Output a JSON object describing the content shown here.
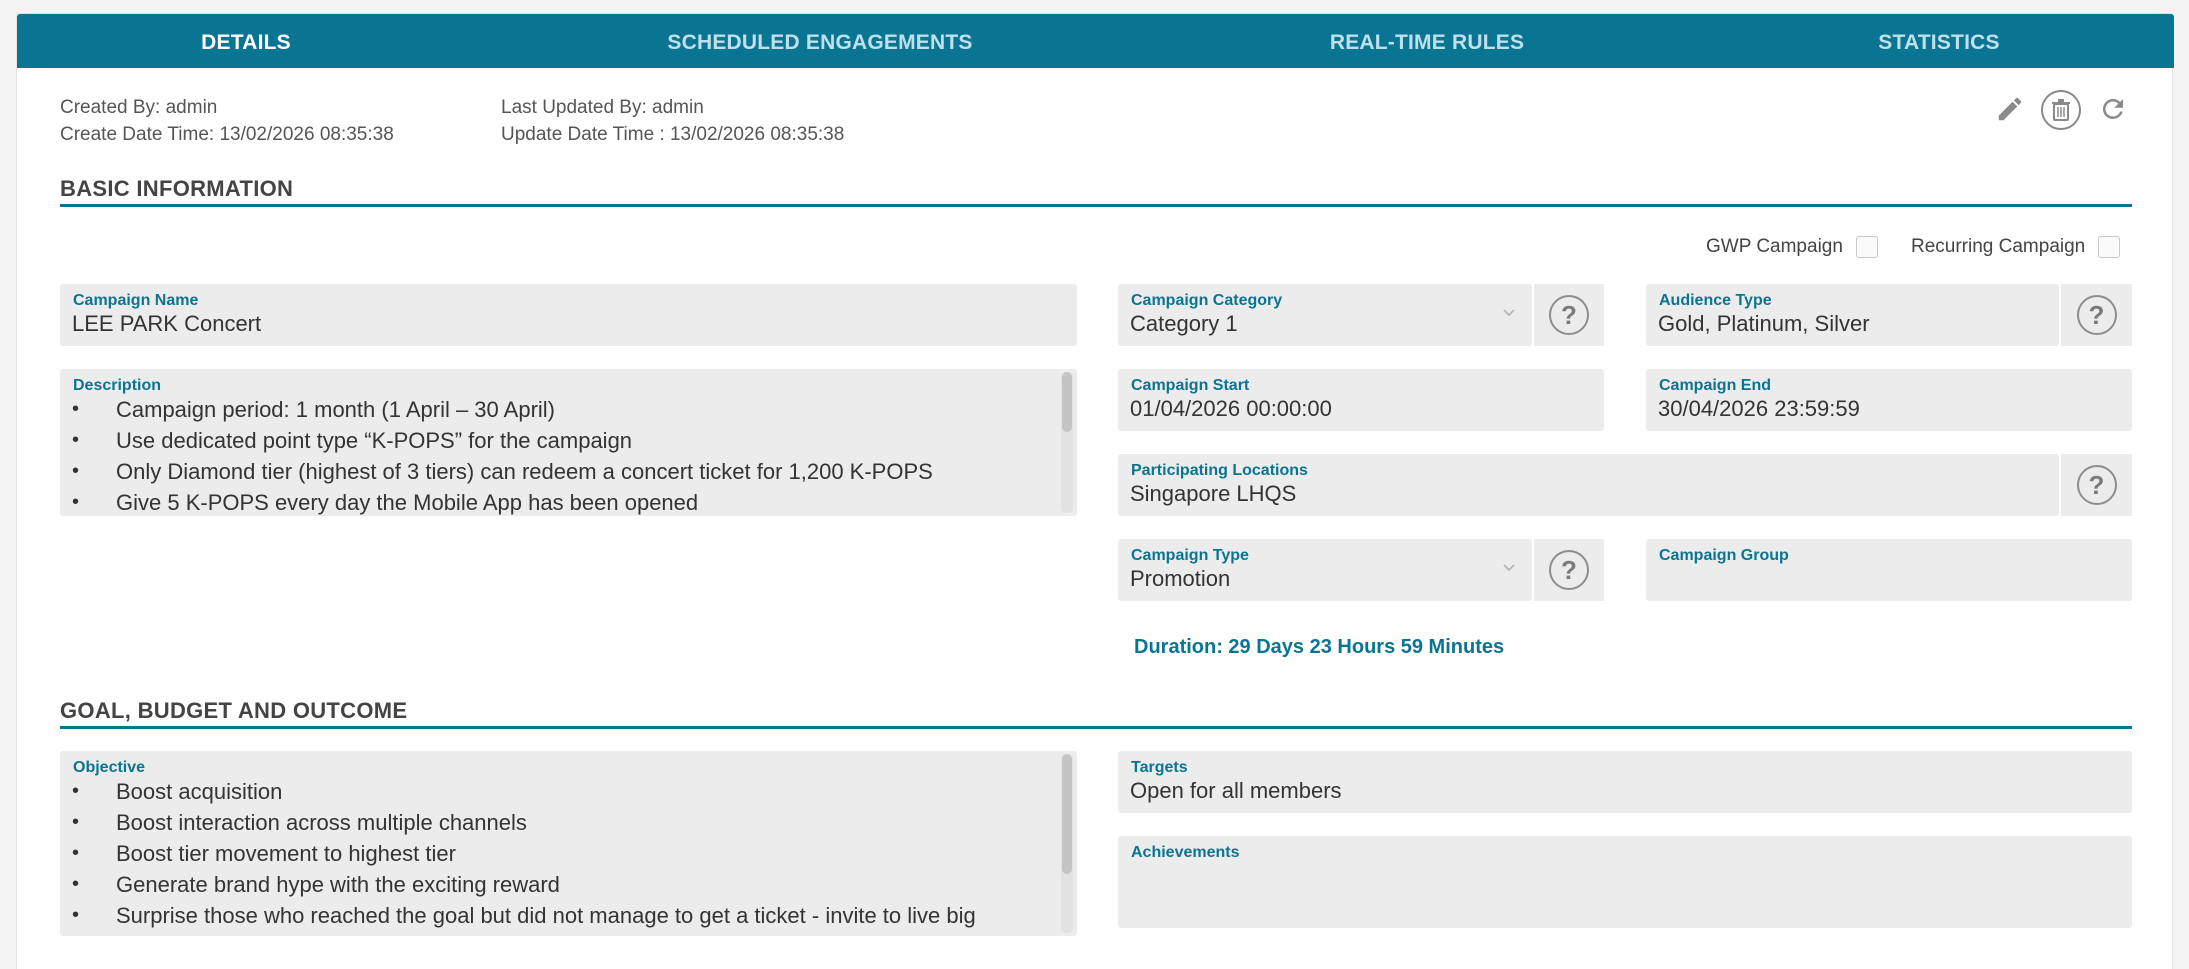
{
  "tabs": [
    {
      "label": "DETAILS",
      "active": true
    },
    {
      "label": "SCHEDULED ENGAGEMENTS",
      "active": false
    },
    {
      "label": "REAL-TIME RULES",
      "active": false
    },
    {
      "label": "STATISTICS",
      "active": false
    }
  ],
  "audit": {
    "created_by": "Created By: admin",
    "create_time": "Create Date Time: 13/02/2026 08:35:38",
    "updated_by": "Last Updated By: admin",
    "update_time": "Update Date Time : 13/02/2026 08:35:38"
  },
  "toolbar_icons": [
    "pencil-icon",
    "trash-icon",
    "refresh-icon"
  ],
  "basic": {
    "title": "BASIC INFORMATION",
    "gwp_label": "GWP Campaign",
    "gwp_checked": false,
    "recurring_label": "Recurring Campaign",
    "recurring_checked": false,
    "campaign_name": {
      "label": "Campaign Name",
      "value": "LEE PARK Concert"
    },
    "description": {
      "label": "Description",
      "items": [
        "Campaign period: 1 month (1 April – 30 April)",
        "Use dedicated point type “K-POPS” for the campaign",
        "Only Diamond tier (highest of 3 tiers) can redeem a concert ticket for 1,200 K-POPS",
        "Give 5 K-POPS every day the Mobile App has been opened"
      ]
    },
    "campaign_category": {
      "label": "Campaign Category",
      "value": "Category 1"
    },
    "audience_type": {
      "label": "Audience Type",
      "value": "Gold, Platinum, Silver"
    },
    "campaign_start": {
      "label": "Campaign Start",
      "value": "01/04/2026 00:00:00"
    },
    "campaign_end": {
      "label": "Campaign End",
      "value": "30/04/2026 23:59:59"
    },
    "participating_locations": {
      "label": "Participating Locations",
      "value": "Singapore LHQS"
    },
    "campaign_type": {
      "label": "Campaign Type",
      "value": "Promotion"
    },
    "campaign_group": {
      "label": "Campaign Group",
      "value": ""
    },
    "duration": "Duration: 29 Days 23 Hours 59 Minutes"
  },
  "goal": {
    "title": "GOAL, BUDGET AND OUTCOME",
    "objective": {
      "label": "Objective",
      "items": [
        "Boost acquisition",
        "Boost interaction across multiple channels",
        "Boost tier movement to highest tier",
        "Generate brand hype with the exciting reward",
        "Surprise those who reached the goal but did not manage to get a ticket - invite to live big"
      ]
    },
    "targets": {
      "label": "Targets",
      "value": "Open for all members"
    },
    "achievements": {
      "label": "Achievements",
      "value": ""
    }
  },
  "colors": {
    "accent": "#0a7592",
    "field_bg": "#ececec",
    "tab_inactive_text": "#bfe0ea"
  },
  "help_icon": "?"
}
